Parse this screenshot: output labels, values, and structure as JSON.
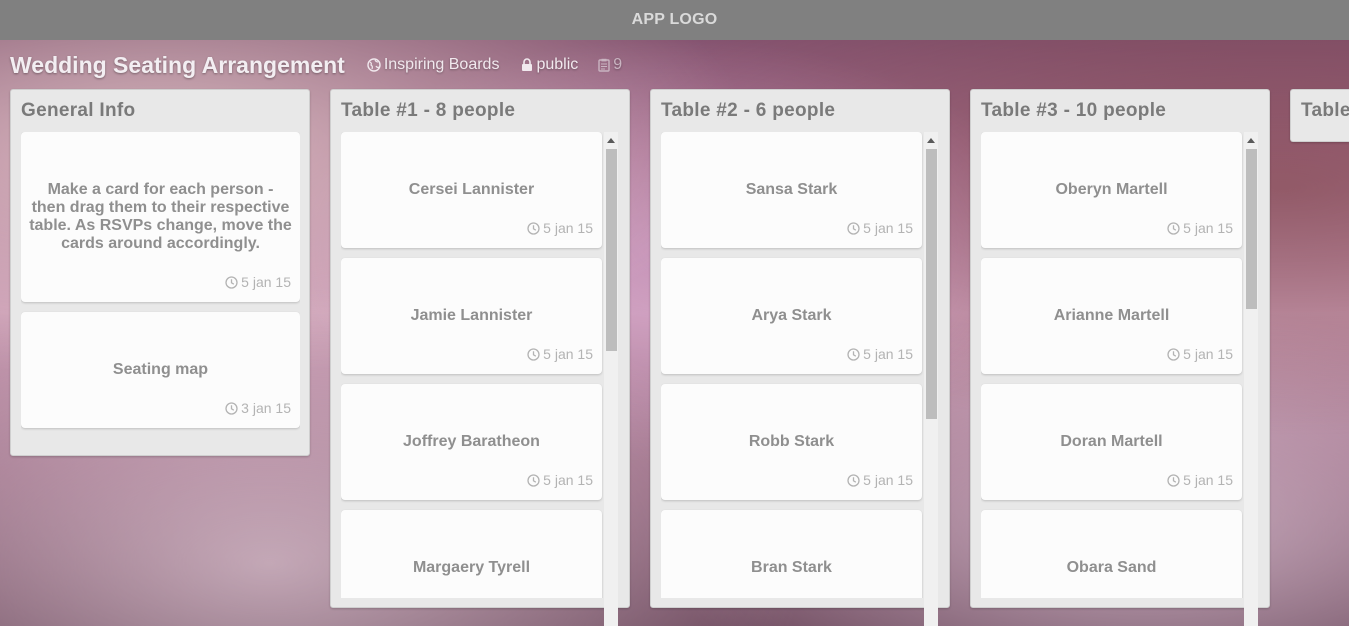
{
  "app": {
    "logo": "APP LOGO"
  },
  "board": {
    "title": "Wedding Seating Arrangement",
    "category": "Inspiring Boards",
    "visibility": "public",
    "count": "9"
  },
  "columns": [
    {
      "title": "General Info",
      "cards": [
        {
          "name": "Make a card for each person - then drag them to their respective table. As RSVPs change, move the cards around accordingly.",
          "date": "5 jan 15"
        },
        {
          "name": "Seating map",
          "date": "3 jan 15"
        }
      ]
    },
    {
      "title": "Table #1 - 8 people",
      "cards": [
        {
          "name": "Cersei Lannister",
          "date": "5 jan 15"
        },
        {
          "name": "Jamie Lannister",
          "date": "5 jan 15"
        },
        {
          "name": "Joffrey Baratheon",
          "date": "5 jan 15"
        },
        {
          "name": "Margaery Tyrell",
          "date": ""
        }
      ]
    },
    {
      "title": "Table #2 - 6 people",
      "cards": [
        {
          "name": "Sansa Stark",
          "date": "5 jan 15"
        },
        {
          "name": "Arya Stark",
          "date": "5 jan 15"
        },
        {
          "name": "Robb Stark",
          "date": "5 jan 15"
        },
        {
          "name": "Bran Stark",
          "date": ""
        }
      ]
    },
    {
      "title": "Table #3 - 10 people",
      "cards": [
        {
          "name": "Oberyn Martell",
          "date": "5 jan 15"
        },
        {
          "name": "Arianne Martell",
          "date": "5 jan 15"
        },
        {
          "name": "Doran Martell",
          "date": "5 jan 15"
        },
        {
          "name": "Obara Sand",
          "date": ""
        }
      ]
    },
    {
      "title": "Table",
      "cards": []
    }
  ]
}
